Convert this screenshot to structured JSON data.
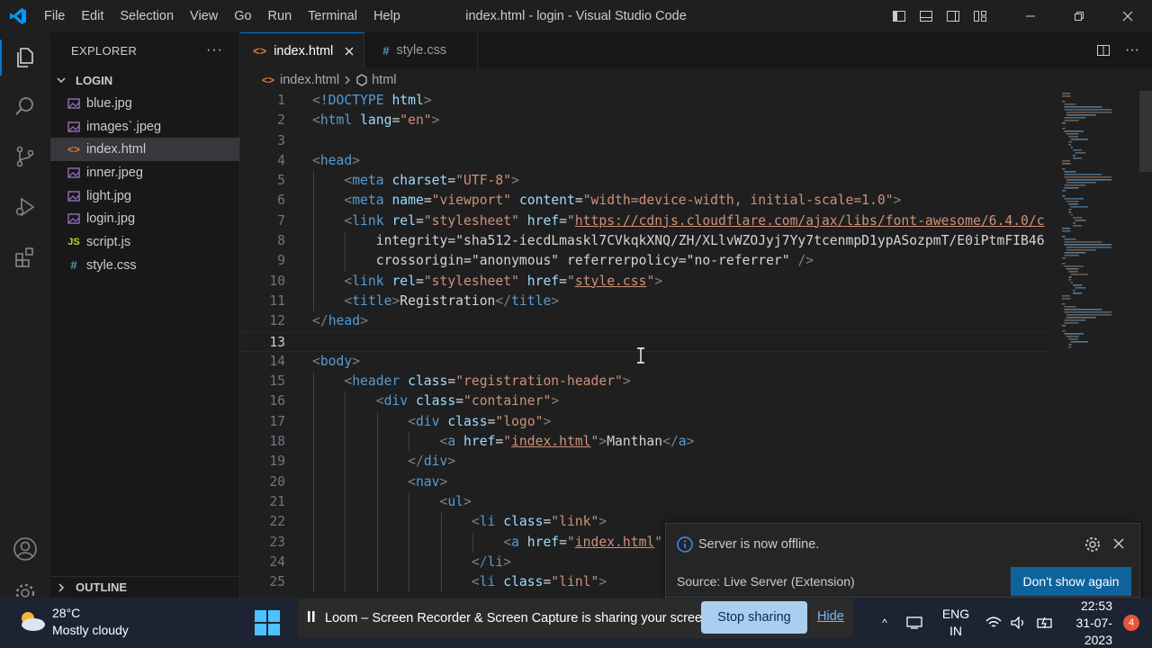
{
  "titlebar": {
    "logo_icon": "vscode-icon",
    "menu": [
      "File",
      "Edit",
      "Selection",
      "View",
      "Go",
      "Run",
      "Terminal",
      "Help"
    ],
    "window_title": "index.html - login - Visual Studio Code"
  },
  "activitybar": {
    "items": [
      "explorer-icon",
      "search-icon",
      "source-control-icon",
      "run-debug-icon",
      "extensions-icon"
    ],
    "bottom": [
      "accounts-icon",
      "manage-icon"
    ]
  },
  "sidebar": {
    "title": "EXPLORER",
    "folder": "LOGIN",
    "files": [
      {
        "name": "blue.jpg",
        "type": "image"
      },
      {
        "name": "images`.jpeg",
        "type": "image"
      },
      {
        "name": "index.html",
        "type": "html",
        "selected": true
      },
      {
        "name": "inner.jpeg",
        "type": "image"
      },
      {
        "name": "light.jpg",
        "type": "image"
      },
      {
        "name": "login.jpg",
        "type": "image"
      },
      {
        "name": "script.js",
        "type": "js"
      },
      {
        "name": "style.css",
        "type": "css"
      }
    ],
    "outline": "OUTLINE"
  },
  "tabs": [
    {
      "label": "index.html",
      "active": true
    },
    {
      "label": "style.css",
      "active": false
    }
  ],
  "breadcrumb": {
    "file": "index.html",
    "symbol": "html"
  },
  "editor": {
    "current_line": 13,
    "lines": [
      "<!DOCTYPE html>",
      "<html lang=\"en\">",
      "",
      "<head>",
      "    <meta charset=\"UTF-8\">",
      "    <meta name=\"viewport\" content=\"width=device-width, initial-scale=1.0\">",
      "    <link rel=\"stylesheet\" href=\"https://cdnjs.cloudflare.com/ajax/libs/font-awesome/6.4.0/c",
      "        integrity=\"sha512-iecdLmaskl7CVkqkXNQ/ZH/XLlvWZOJyj7Yy7tcenmpD1ypASozpmT/E0iPtmFIB46",
      "        crossorigin=\"anonymous\" referrerpolicy=\"no-referrer\" />",
      "    <link rel=\"stylesheet\" href=\"style.css\">",
      "    <title>Registration</title>",
      "</head>",
      "",
      "<body>",
      "    <header class=\"registration-header\">",
      "        <div class=\"container\">",
      "            <div class=\"logo\">",
      "                <a href=\"index.html\">Manthan</a>",
      "            </div>",
      "            <nav>",
      "                <ul>",
      "                    <li class=\"link\">",
      "                        <a href=\"index.html\"",
      "                    </li>",
      "                    <li class=\"linl\">"
    ]
  },
  "notification": {
    "message": "Server is now offline.",
    "source": "Source: Live Server (Extension)",
    "button": "Don't show again"
  },
  "taskbar": {
    "temperature": "28°C",
    "weather": "Mostly cloudy",
    "share_message": "Loom – Screen Recorder & Screen Capture is sharing your screen.",
    "stop_sharing": "Stop sharing",
    "hide": "Hide",
    "lang_line1": "ENG",
    "lang_line2": "IN",
    "time": "22:53",
    "date": "31-07-2023",
    "badge": "4"
  },
  "colors": {
    "accent": "#0078d4",
    "tag": "#569cd6",
    "attr": "#9cdcfe",
    "string": "#ce9178",
    "button": "#0e639c"
  }
}
